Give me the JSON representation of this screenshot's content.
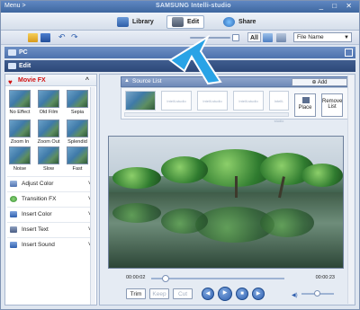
{
  "title": {
    "menu": "Menu >",
    "brand": "SAMSUNG Intelli-studio",
    "controls": "_ □ ✕"
  },
  "modes": [
    {
      "label": "Library"
    },
    {
      "label": "Edit"
    },
    {
      "label": "Share"
    }
  ],
  "toolbar": {
    "all": "All",
    "sort_value": "File Name"
  },
  "pc_label": "PC",
  "edit_label": "Edit",
  "fx": {
    "header": "Movie FX",
    "effects": [
      "No Effect",
      "Old Film",
      "Sepia",
      "Zoom In",
      "Zoom Out",
      "Splendid",
      "Noise",
      "Slow",
      "Fast"
    ],
    "accordion": [
      "Adjust Color",
      "Transition FX",
      "Insert Color",
      "Insert Text",
      "Insert Sound"
    ]
  },
  "source": {
    "header": "Source List",
    "add": "Add",
    "slot_text": "Intelli-studio",
    "place": "Place",
    "remove": "Remove List"
  },
  "player": {
    "time_current": "00:00:02",
    "time_total": "00:00:23",
    "trim": "Trim",
    "keep": "Keep",
    "cut": "Cut"
  },
  "colors": {
    "accent": "#2f5fae",
    "title_bar": "#4a74b3",
    "fx_header": "#d01010"
  }
}
